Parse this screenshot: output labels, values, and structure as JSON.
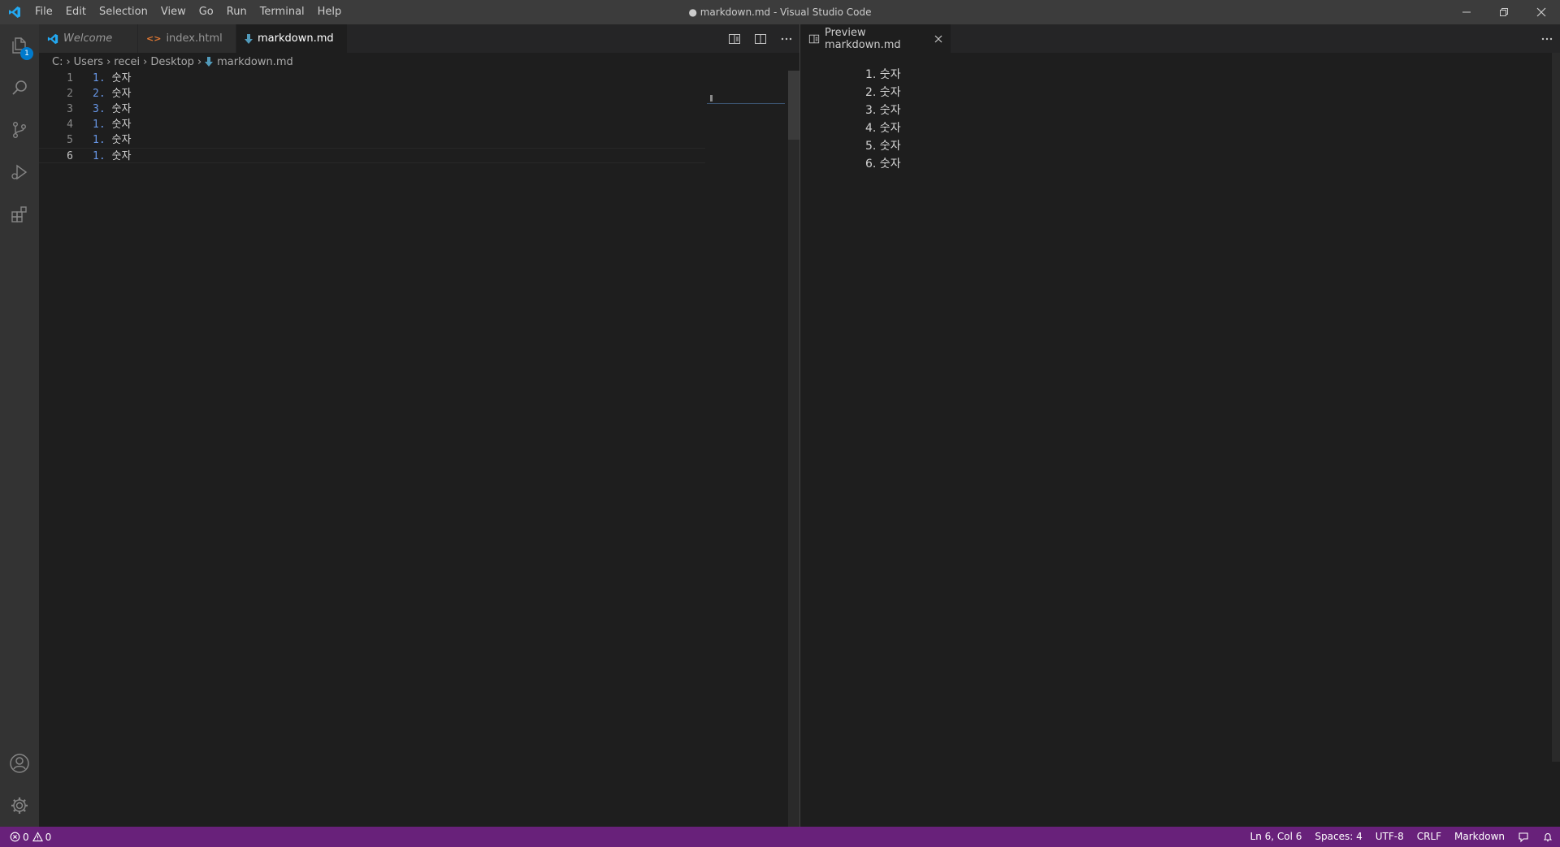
{
  "window": {
    "title": "● markdown.md - Visual Studio Code",
    "menu": [
      "File",
      "Edit",
      "Selection",
      "View",
      "Go",
      "Run",
      "Terminal",
      "Help"
    ]
  },
  "activity_bar": {
    "explorer_badge": "1",
    "icons": [
      "explorer-icon",
      "search-icon",
      "source-control-icon",
      "run-debug-icon",
      "extensions-icon",
      "account-icon",
      "settings-gear-icon"
    ]
  },
  "editor": {
    "tabs": [
      {
        "label": "Welcome",
        "icon": "vscode-icon",
        "italic": true
      },
      {
        "label": "index.html",
        "icon": "html-icon"
      },
      {
        "label": "markdown.md",
        "icon": "markdown-icon",
        "dirty": true
      }
    ],
    "breadcrumb": [
      "C:",
      "Users",
      "recei",
      "Desktop",
      "markdown.md"
    ],
    "lines": [
      {
        "num": "1",
        "marker": "1.",
        "text": "숫자"
      },
      {
        "num": "2",
        "marker": "2.",
        "text": "숫자"
      },
      {
        "num": "3",
        "marker": "3.",
        "text": "숫자"
      },
      {
        "num": "4",
        "marker": "1.",
        "text": "숫자"
      },
      {
        "num": "5",
        "marker": "1.",
        "text": "숫자"
      },
      {
        "num": "6",
        "marker": "1.",
        "text": "숫자"
      }
    ]
  },
  "preview": {
    "tab_label": "Preview markdown.md",
    "items": [
      "1. 숫자",
      "2. 숫자",
      "3. 숫자",
      "4. 숫자",
      "5. 숫자",
      "6. 숫자"
    ]
  },
  "status_bar": {
    "errors": "0",
    "warnings": "0",
    "cursor": "Ln 6, Col 6",
    "spaces": "Spaces: 4",
    "encoding": "UTF-8",
    "eol": "CRLF",
    "language": "Markdown",
    "color": "#68217a"
  },
  "colors": {
    "accent": "#007acc",
    "number_token": "#6796e6"
  }
}
